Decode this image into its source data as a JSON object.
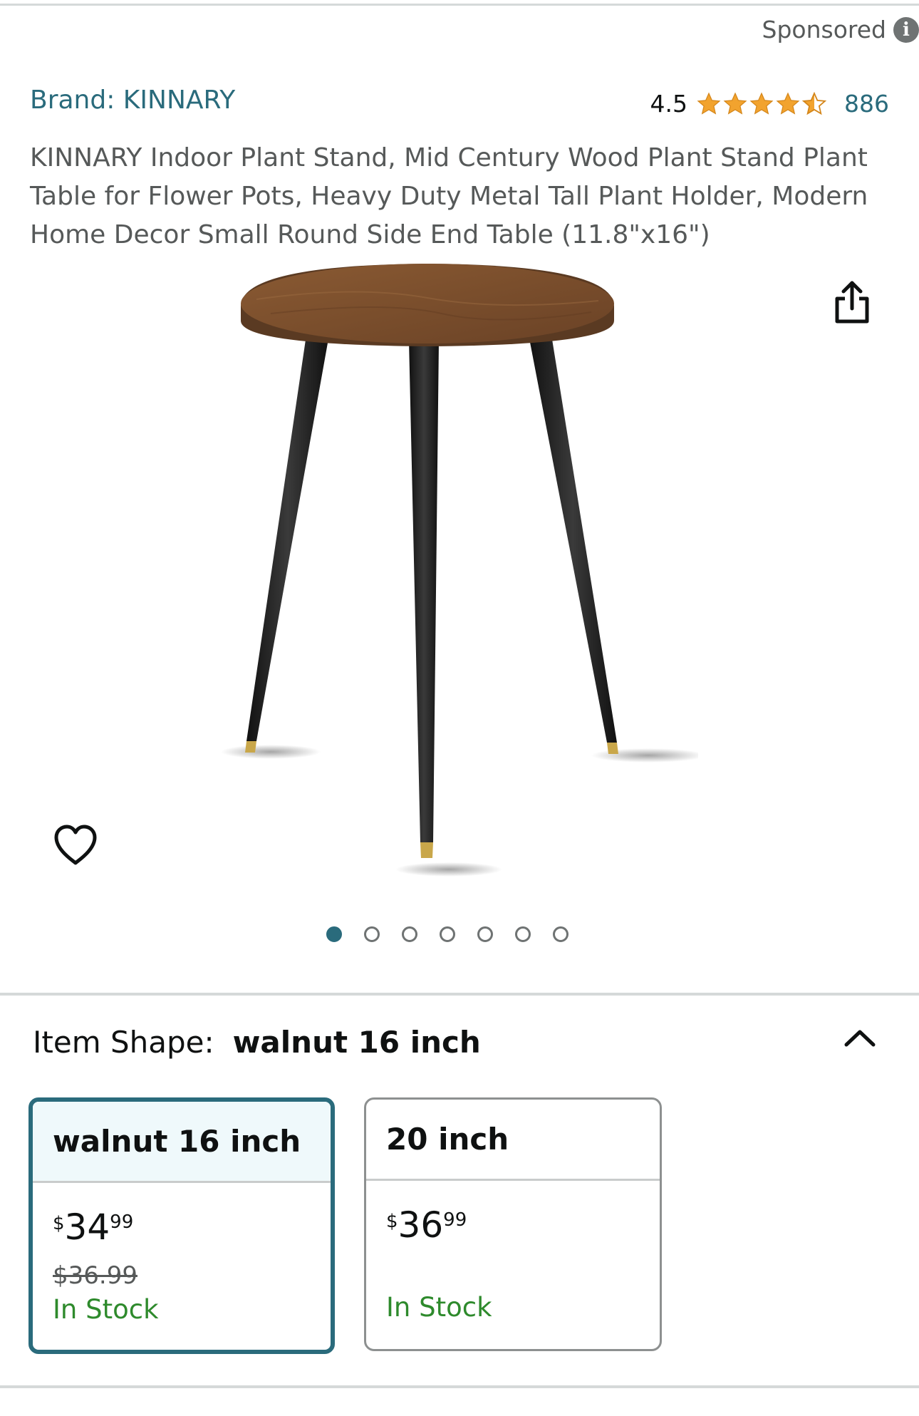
{
  "sponsored": {
    "label": "Sponsored",
    "icon": "info-icon"
  },
  "product": {
    "brand": "Brand: KINNARY",
    "rating_value": "4.5",
    "rating_stars": 4.5,
    "rating_count": "886",
    "title": "KINNARY Indoor Plant Stand, Mid Century Wood Plant Stand Plant Table for Flower Pots, Heavy Duty Metal Tall Plant Holder, Modern Home Decor Small Round Side End Table (11.8\"x16\")"
  },
  "gallery": {
    "image_count": 7,
    "active_index": 0,
    "share_icon": "share-icon",
    "wishlist_icon": "heart-icon"
  },
  "variation": {
    "label": "Item Shape:",
    "selected_value": "walnut 16 inch",
    "toggle_icon": "chevron-up-icon",
    "options": [
      {
        "name": "walnut 16 inch",
        "price_symbol": "$",
        "price_whole": "34",
        "price_fraction": "99",
        "was_price": "$36.99",
        "availability": "In Stock",
        "selected": true
      },
      {
        "name": "20 inch",
        "price_symbol": "$",
        "price_whole": "36",
        "price_fraction": "99",
        "availability": "In Stock",
        "selected": false
      }
    ]
  },
  "colors": {
    "accent": "#2a6b7c",
    "star": "#f2a32e",
    "in_stock": "#2e8a2c"
  }
}
